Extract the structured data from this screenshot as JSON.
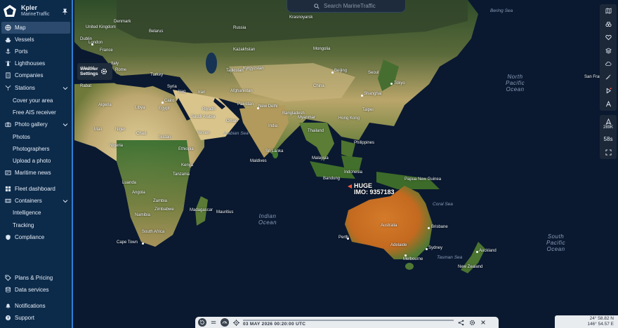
{
  "brand": {
    "name": "Kpler",
    "subtitle": "MarineTraffic"
  },
  "nav": {
    "map": "Map",
    "vessels": "Vessels",
    "ports": "Ports",
    "lighthouses": "Lighthouses",
    "companies": "Companies",
    "stations": "Stations",
    "cover_area": "Cover your area",
    "free_ais": "Free AIS receiver",
    "photo_gallery": "Photo gallery",
    "photos": "Photos",
    "photographers": "Photographers",
    "upload_photo": "Upload a photo",
    "maritime_news": "Maritime news",
    "fleet_dashboard": "Fleet dashboard",
    "containers": "Containers",
    "intelligence": "Intelligence",
    "tracking": "Tracking",
    "compliance": "Compliance",
    "plans_pricing": "Plans & Pricing",
    "data_services": "Data services",
    "notifications": "Notifications",
    "support": "Support"
  },
  "search": {
    "placeholder": "Search MarineTraffic"
  },
  "weather": {
    "line1": "Weather",
    "line2": "Settings"
  },
  "toolbar": {
    "vessel_count": "289K",
    "refresh": "58s"
  },
  "vessel": {
    "name": "HUGE",
    "imo": "IMO: 9357183"
  },
  "timeline": {
    "datetime": "03 MAY 2026 00:20:00 UTC"
  },
  "coordinates": {
    "lat": "24° 58.82 N",
    "lon": "146° 54.57 E"
  },
  "map_labels": {
    "oceans": {
      "north_pacific": "North Pacific Ocean",
      "south_pacific": "South Pacific Ocean",
      "indian": "Indian Ocean",
      "arabian_sea": "Arabian Sea",
      "bering_sea": "Bering Sea",
      "coral_sea": "Coral Sea",
      "tasman_sea": "Tasman Sea"
    },
    "places": {
      "united_kingdom": "United Kingdom",
      "denmark": "Denmark",
      "belarus": "Belarus",
      "russia": "Russia",
      "krasnoyarsk": "Krasnoyarsk",
      "dublin": "Dublin",
      "london": "London",
      "france": "France",
      "kazakhstan": "Kazakhstan",
      "mongolia": "Mongolia",
      "kyrgyzstan": "Kyrgyzstan",
      "tajikistan": "Tajikistan",
      "beijing": "Beijing",
      "seoul": "Seoul",
      "tokyo": "Tokyo",
      "madrid": "Madrid",
      "italy": "Italy",
      "rome": "Rome",
      "turkey": "Turkey",
      "syria": "Syria",
      "iraq": "Iraq",
      "iran": "Iran",
      "afghanistan": "Afghanistan",
      "pakistan": "Pakistan",
      "china": "China",
      "shanghai": "Shanghai",
      "taipei": "Taipei",
      "rabat": "Rabat",
      "algeria": "Algeria",
      "libya": "Libya",
      "egypt": "Egypt",
      "cairo": "Cairo",
      "saudi_arabia": "Saudi Arabia",
      "riyadh": "Riyadh",
      "oman": "Oman",
      "new_delhi": "New Delhi",
      "india": "India",
      "bangladesh": "Bangladesh",
      "myanmar": "Myanmar",
      "hong_kong": "Hong Kong",
      "mali": "Mali",
      "niger": "Niger",
      "chad": "Chad",
      "sudan": "Sudan",
      "yemen": "Yemen",
      "thailand": "Thailand",
      "philippines": "Philippines",
      "nigeria": "Nigeria",
      "ethiopia": "Ethiopia",
      "sri_lanka": "Sri Lanka",
      "malaysia": "Malaysia",
      "maldives": "Maldives",
      "kenya": "Kenya",
      "indonesia": "Indonesia",
      "bandung": "Bandung",
      "papua_new_guinea": "Papua New Guinea",
      "tanzania": "Tanzania",
      "luanda": "Luanda",
      "angola": "Angola",
      "zambia": "Zambia",
      "zimbabwe": "Zimbabwe",
      "namibia": "Namibia",
      "madagascar": "Madagascar",
      "mauritius": "Mauritius",
      "australia": "Australia",
      "brisbane": "Brisbane",
      "south_africa": "South Africa",
      "perth": "Perth",
      "adelaide": "Adelaide",
      "sydney": "Sydney",
      "cape_town": "Cape Town",
      "melbourne": "Melbourne",
      "auckland": "Auckland",
      "new_zealand": "New Zealand",
      "san_fran": "San Fran"
    }
  }
}
